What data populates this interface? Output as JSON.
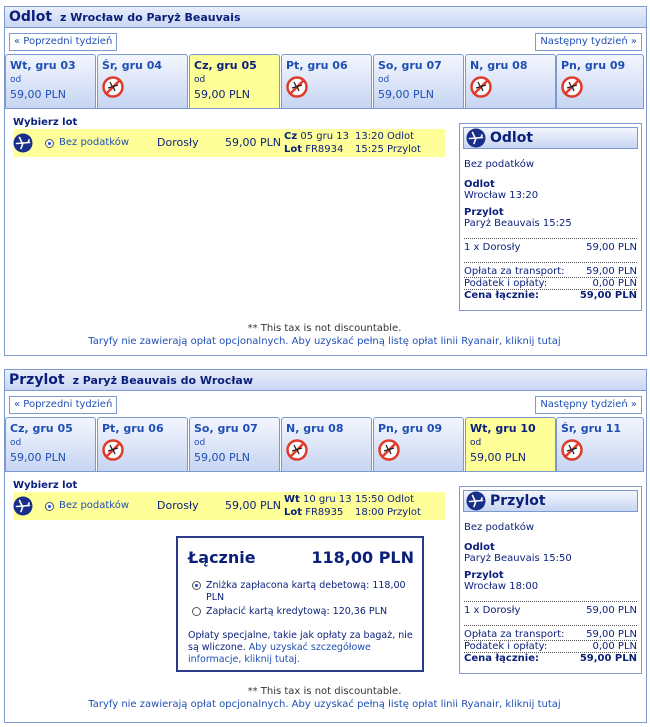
{
  "outbound": {
    "title": "Odlot",
    "route": "z Wrocław do Paryż Beauvais",
    "prev_week": "« Poprzedni tydzień",
    "next_week": "Następny tydzień »",
    "days": [
      {
        "label": "Wt, gru 03",
        "od": "od",
        "price": "59,00 PLN",
        "available": true,
        "selected": false
      },
      {
        "label": "Śr, gru 04",
        "available": false,
        "selected": false
      },
      {
        "label": "Cz, gru 05",
        "od": "od",
        "price": "59,00 PLN",
        "available": true,
        "selected": true
      },
      {
        "label": "Pt, gru 06",
        "available": false,
        "selected": false
      },
      {
        "label": "So, gru 07",
        "od": "od",
        "price": "59,00 PLN",
        "available": true,
        "selected": false
      },
      {
        "label": "N, gru 08",
        "available": false,
        "selected": false
      },
      {
        "label": "Pn, gru 09",
        "available": false,
        "selected": false
      }
    ],
    "pick_title": "Wybierz lot",
    "flight": {
      "tax": "Bez podatków",
      "passenger": "Dorosły",
      "price": "59,00 PLN",
      "day": "Cz",
      "date": "05 gru 13",
      "flight_label": "Lot",
      "flight_no": "FR8934",
      "depart": "13:20 Odlot",
      "arrive": "15:25 Przylot"
    },
    "summary": {
      "title": "Odlot",
      "tax": "Bez podatków",
      "dep_label": "Odlot",
      "dep_value": "Wrocław 13:20",
      "arr_label": "Przylot",
      "arr_value": "Paryż Beauvais 15:25",
      "pax_label": "1 x Dorosły",
      "pax_price": "59,00 PLN",
      "transport_label": "Opłata za transport:",
      "transport_value": "59,00 PLN",
      "fees_label": "Podatek i opłaty:",
      "fees_value": "0,00 PLN",
      "total_label": "Cena łącznie:",
      "total_value": "59,00 PLN"
    },
    "note1": "** This tax is not discountable.",
    "note2": "Taryfy nie zawierają opłat opcjonalnych. Aby uzyskać pełną listę opłat linii Ryanair, kliknij tutaj"
  },
  "inbound": {
    "title": "Przylot",
    "route": "z Paryż Beauvais do Wrocław",
    "prev_week": "« Poprzedni tydzień",
    "next_week": "Następny tydzień »",
    "days": [
      {
        "label": "Cz, gru 05",
        "od": "od",
        "price": "59,00 PLN",
        "available": true,
        "selected": false
      },
      {
        "label": "Pt, gru 06",
        "available": false,
        "selected": false
      },
      {
        "label": "So, gru 07",
        "od": "od",
        "price": "59,00 PLN",
        "available": true,
        "selected": false
      },
      {
        "label": "N, gru 08",
        "available": false,
        "selected": false
      },
      {
        "label": "Pn, gru 09",
        "available": false,
        "selected": false
      },
      {
        "label": "Wt, gru 10",
        "od": "od",
        "price": "59,00 PLN",
        "available": true,
        "selected": true
      },
      {
        "label": "Śr, gru 11",
        "available": false,
        "selected": false
      }
    ],
    "pick_title": "Wybierz lot",
    "flight": {
      "tax": "Bez podatków",
      "passenger": "Dorosły",
      "price": "59,00 PLN",
      "day": "Wt",
      "date": "10 gru 13",
      "flight_label": "Lot",
      "flight_no": "FR8935",
      "depart": "15:50 Odlot",
      "arrive": "18:00 Przylot"
    },
    "summary": {
      "title": "Przylot",
      "tax": "Bez podatków",
      "dep_label": "Odlot",
      "dep_value": "Paryż Beauvais 15:50",
      "arr_label": "Przylot",
      "arr_value": "Wrocław 18:00",
      "pax_label": "1 x Dorosły",
      "pax_price": "59,00 PLN",
      "transport_label": "Opłata za transport:",
      "transport_value": "59,00 PLN",
      "fees_label": "Podatek i opłaty:",
      "fees_value": "0,00 PLN",
      "total_label": "Cena łącznie:",
      "total_value": "59,00 PLN"
    },
    "note1": "** This tax is not discountable.",
    "note2": "Taryfy nie zawierają opłat opcjonalnych. Aby uzyskać pełną listę opłat linii Ryanair, kliknij tutaj"
  },
  "total": {
    "label": "Łącznie",
    "value": "118,00 PLN",
    "option1": "Zniżka zapłacona kartą debetową: 118,00 PLN",
    "option2": "Zapłacić kartą kredytową: 120,36 PLN",
    "info_text": "Opłaty specjalne, takie jak opłaty za bagaż, nie są wliczone.",
    "info_link": "Aby uzyskać szczegółowe informacje, kliknij tutaj."
  },
  "colors": {
    "selected_day": "#ffff99",
    "border": "#7d9ad0",
    "link": "#1f4fb4",
    "text": "#0a1f7a"
  }
}
